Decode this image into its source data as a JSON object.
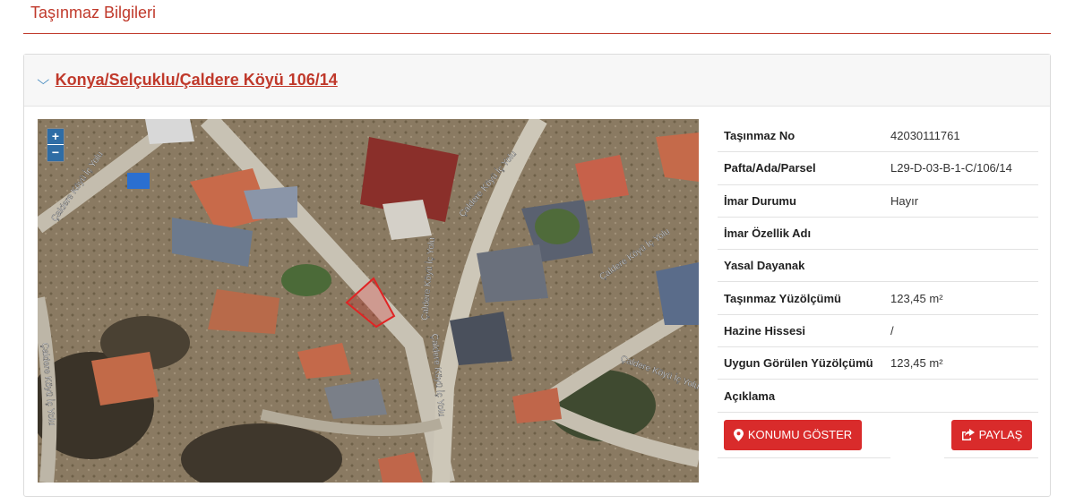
{
  "page": {
    "title": "Taşınmaz Bilgileri"
  },
  "card": {
    "header_link": "Konya/Selçuklu/Çaldere Köyü 106/14"
  },
  "map": {
    "zoom_in": "+",
    "zoom_out": "−",
    "road_labels": [
      "Çaldere Köyü İç Yolu",
      "Çaldere Köyü İç Yolu",
      "Çaldere Köyü İç Yolu",
      "Çaldere Köyü İç Yolu",
      "Çaldere Köyü İç Yolu",
      "Çaldere Köyü İç Yolu",
      "Çaldere Köyü İç Yolu"
    ],
    "parcel_color": "#e02424"
  },
  "info": {
    "rows": [
      {
        "label": "Taşınmaz No",
        "value": "42030111761"
      },
      {
        "label": "Pafta/Ada/Parsel",
        "value": "L29-D-03-B-1-C/106/14"
      },
      {
        "label": "İmar Durumu",
        "value": "Hayır"
      },
      {
        "label": "İmar Özellik Adı",
        "value": ""
      },
      {
        "label": "Yasal Dayanak",
        "value": ""
      },
      {
        "label": "Taşınmaz Yüzölçümü",
        "value": "123,45 m²"
      },
      {
        "label": "Hazine Hissesi",
        "value": "/"
      },
      {
        "label": "Uygun Görülen Yüzölçümü",
        "value": "123,45 m²"
      },
      {
        "label": "Açıklama",
        "value": ""
      }
    ],
    "show_location_label": "KONUMU GÖSTER",
    "share_label": "PAYLAŞ"
  },
  "colors": {
    "accent": "#c0392b",
    "button": "#d92b2b"
  }
}
